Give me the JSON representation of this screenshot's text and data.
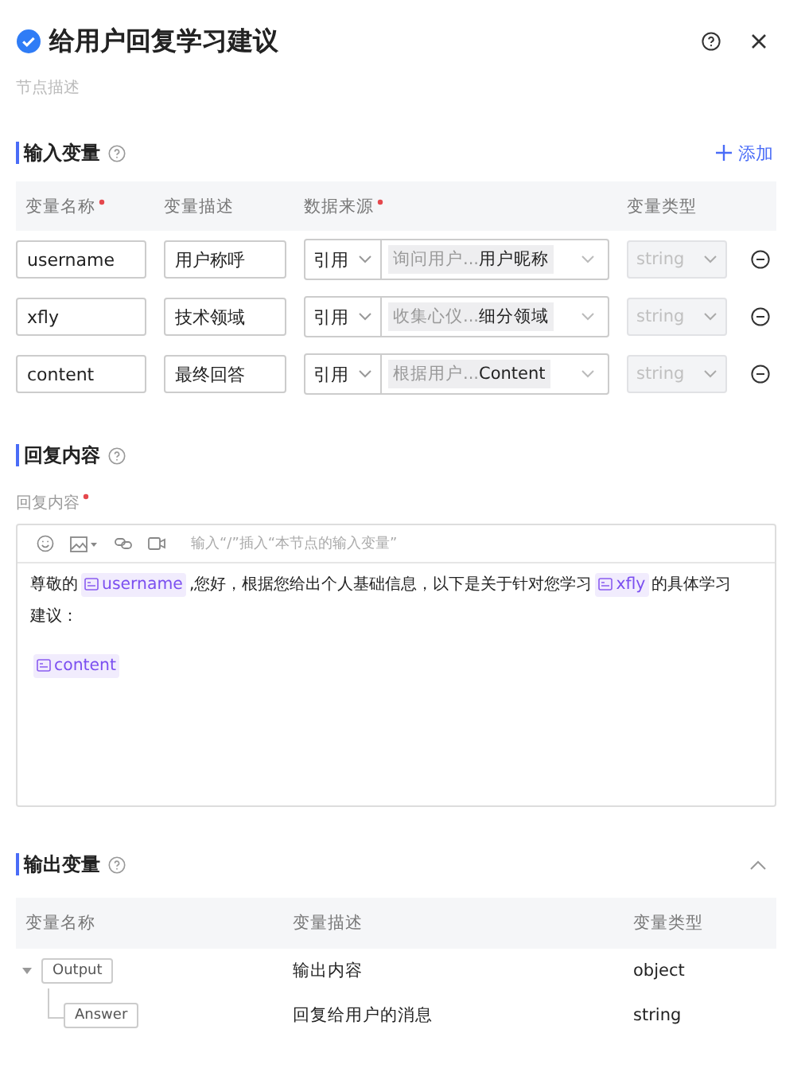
{
  "header": {
    "title": "给用户回复学习建议",
    "description_placeholder": "节点描述"
  },
  "input_section": {
    "title": "输入变量",
    "add_label": "添加",
    "columns": [
      {
        "label": "变量名称",
        "required": true
      },
      {
        "label": "变量描述",
        "required": false
      },
      {
        "label": "数据来源",
        "required": true
      },
      {
        "label": "变量类型",
        "required": false
      }
    ],
    "rows": [
      {
        "name": "username",
        "description": "用户称呼",
        "source_mode": "引用",
        "source_node": "询问用户...",
        "source_field": "用户昵称",
        "type": "string",
        "type_disabled": true
      },
      {
        "name": "xfly",
        "description": "技术领域",
        "source_mode": "引用",
        "source_node": "收集心仪...",
        "source_field": "细分领域",
        "type": "string",
        "type_disabled": true
      },
      {
        "name": "content",
        "description": "最终回答",
        "source_mode": "引用",
        "source_node": "根据用户...",
        "source_field": "Content",
        "type": "string",
        "type_disabled": true
      }
    ]
  },
  "reply_section": {
    "title": "回复内容",
    "field_label": "回复内容",
    "field_required": true,
    "editor_placeholder": "输入“/”插入“本节点的输入变量”",
    "paragraphs": [
      [
        {
          "kind": "text",
          "text": "尊敬的"
        },
        {
          "kind": "variable",
          "text": "username"
        },
        {
          "kind": "text",
          "text": ",您好，根据您给出个人基础信息，以下是关于针对您学习"
        },
        {
          "kind": "variable",
          "text": "xfly"
        },
        {
          "kind": "text",
          "text": "的具体学习"
        },
        {
          "kind": "text",
          "text": "建议："
        }
      ],
      [
        {
          "kind": "variable",
          "text": "content"
        }
      ]
    ]
  },
  "output_section": {
    "title": "输出变量",
    "expanded": true,
    "columns": [
      "变量名称",
      "变量描述",
      "变量类型"
    ],
    "rows": [
      {
        "name": "Output",
        "description": "输出内容",
        "type": "object",
        "expanded": true,
        "children": [
          {
            "name": "Answer",
            "description": "回复给用户的消息",
            "type": "string"
          }
        ]
      }
    ]
  }
}
